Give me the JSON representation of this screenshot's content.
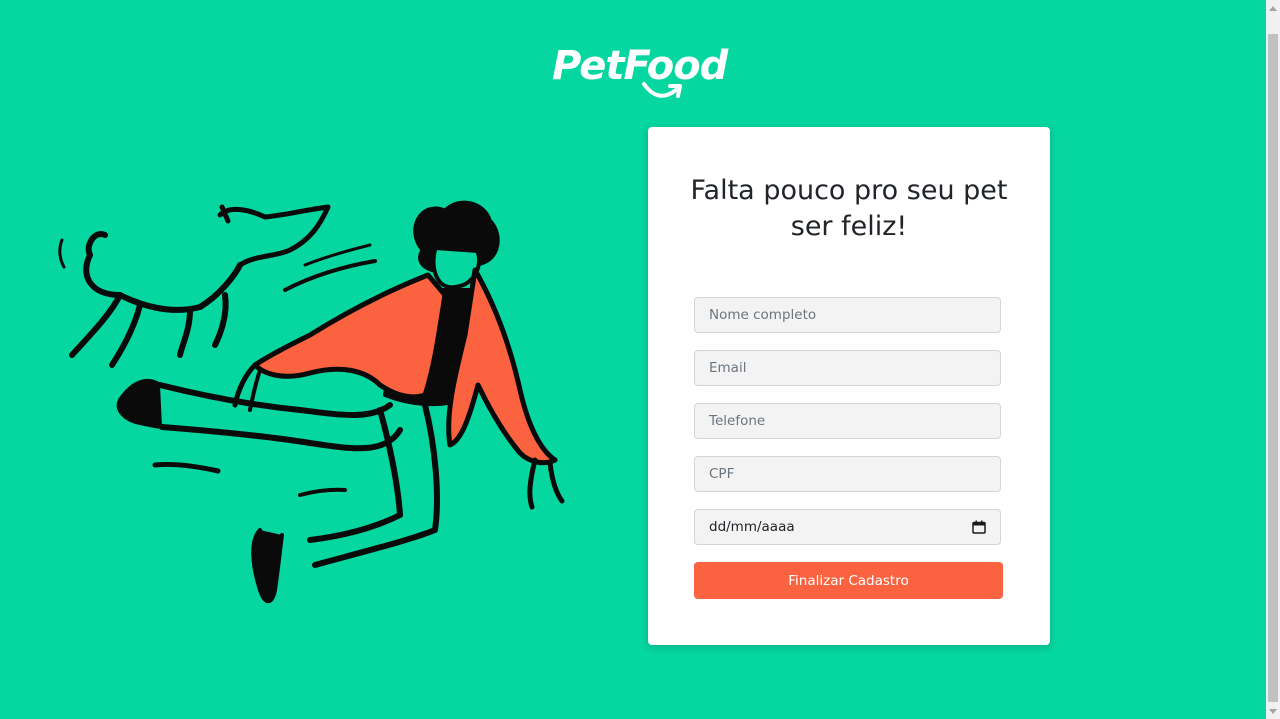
{
  "brand": {
    "name": "PetFood",
    "accent_color": "#06d6a0",
    "button_color": "#fb6340"
  },
  "form": {
    "title": "Falta pouco pro seu pet ser feliz!",
    "fields": {
      "name_placeholder": "Nome completo",
      "email_placeholder": "Email",
      "phone_placeholder": "Telefone",
      "cpf_placeholder": "CPF",
      "date_placeholder": "dd/mm/aaaa"
    },
    "submit_label": "Finalizar Cadastro"
  },
  "icons": {
    "date_picker": "calendar-icon",
    "scroll_up": "chevron-up-icon",
    "scroll_down": "chevron-down-icon"
  }
}
